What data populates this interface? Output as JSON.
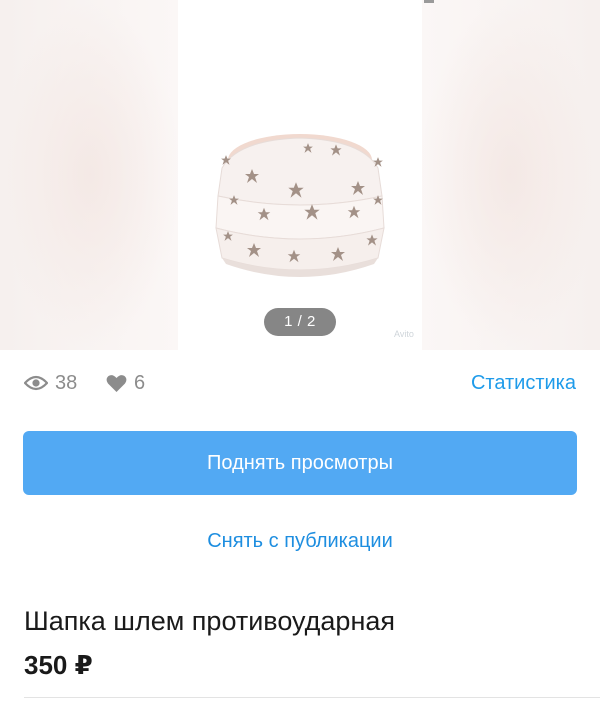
{
  "gallery": {
    "counter": "1 / 2",
    "watermark": "Avito"
  },
  "stats": {
    "views": "38",
    "likes": "6",
    "statistics_link": "Статистика",
    "view_icon": "eye-icon",
    "like_icon": "heart-icon"
  },
  "actions": {
    "primary_label": "Поднять просмотры",
    "secondary_label": "Снять с публикации"
  },
  "item": {
    "title": "Шапка шлем противоударная",
    "price": "350 ₽"
  },
  "colors": {
    "accent": "#1e9bea",
    "primary_button": "#52a9f3",
    "muted_text": "#8c8c8c",
    "star_color": "#9c8f86"
  }
}
